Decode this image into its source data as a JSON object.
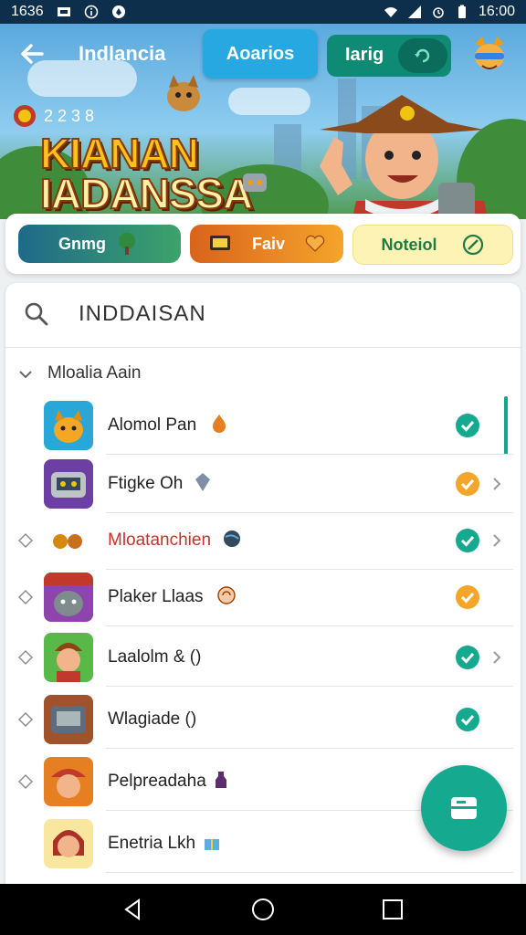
{
  "status_bar": {
    "time_left": "1636",
    "time_right": "16:00"
  },
  "header": {
    "title": "Indlancia",
    "tab_active": "Aoarios",
    "tab_second": "Iarig"
  },
  "hero": {
    "score": "2 2 3 8",
    "logo_line1": "KIANAN",
    "logo_line2": "IADANSSA"
  },
  "filter_pills": [
    {
      "label": "Gnmg"
    },
    {
      "label": "Faiv"
    },
    {
      "label": "Noteiol"
    }
  ],
  "search": {
    "value": "INDDAISAN"
  },
  "section": {
    "label": "Mloalia Aain"
  },
  "items": [
    {
      "name": "Alomol Pan",
      "status": "done",
      "arrow": false,
      "diamond": false,
      "highlight": false
    },
    {
      "name": "Ftigke Oh",
      "status": "pending",
      "arrow": true,
      "diamond": false,
      "highlight": false
    },
    {
      "name": "Mloatanchien",
      "status": "done",
      "arrow": true,
      "diamond": true,
      "highlight": true
    },
    {
      "name": "Plaker Llaas",
      "status": "pending",
      "arrow": false,
      "diamond": true,
      "highlight": false
    },
    {
      "name": "Laalolm & ()",
      "status": "done",
      "arrow": true,
      "diamond": true,
      "highlight": false
    },
    {
      "name": "Wlagiade ()",
      "status": "done",
      "arrow": false,
      "diamond": true,
      "highlight": false
    },
    {
      "name": "Pelpreadaha",
      "status": "none",
      "arrow": false,
      "diamond": true,
      "highlight": false
    },
    {
      "name": "Enetria Lkh",
      "status": "none",
      "arrow": false,
      "diamond": false,
      "highlight": false
    }
  ],
  "colors": {
    "accent": "#15a990",
    "pending": "#f4a62a",
    "header_tab": "#27a8e0"
  }
}
